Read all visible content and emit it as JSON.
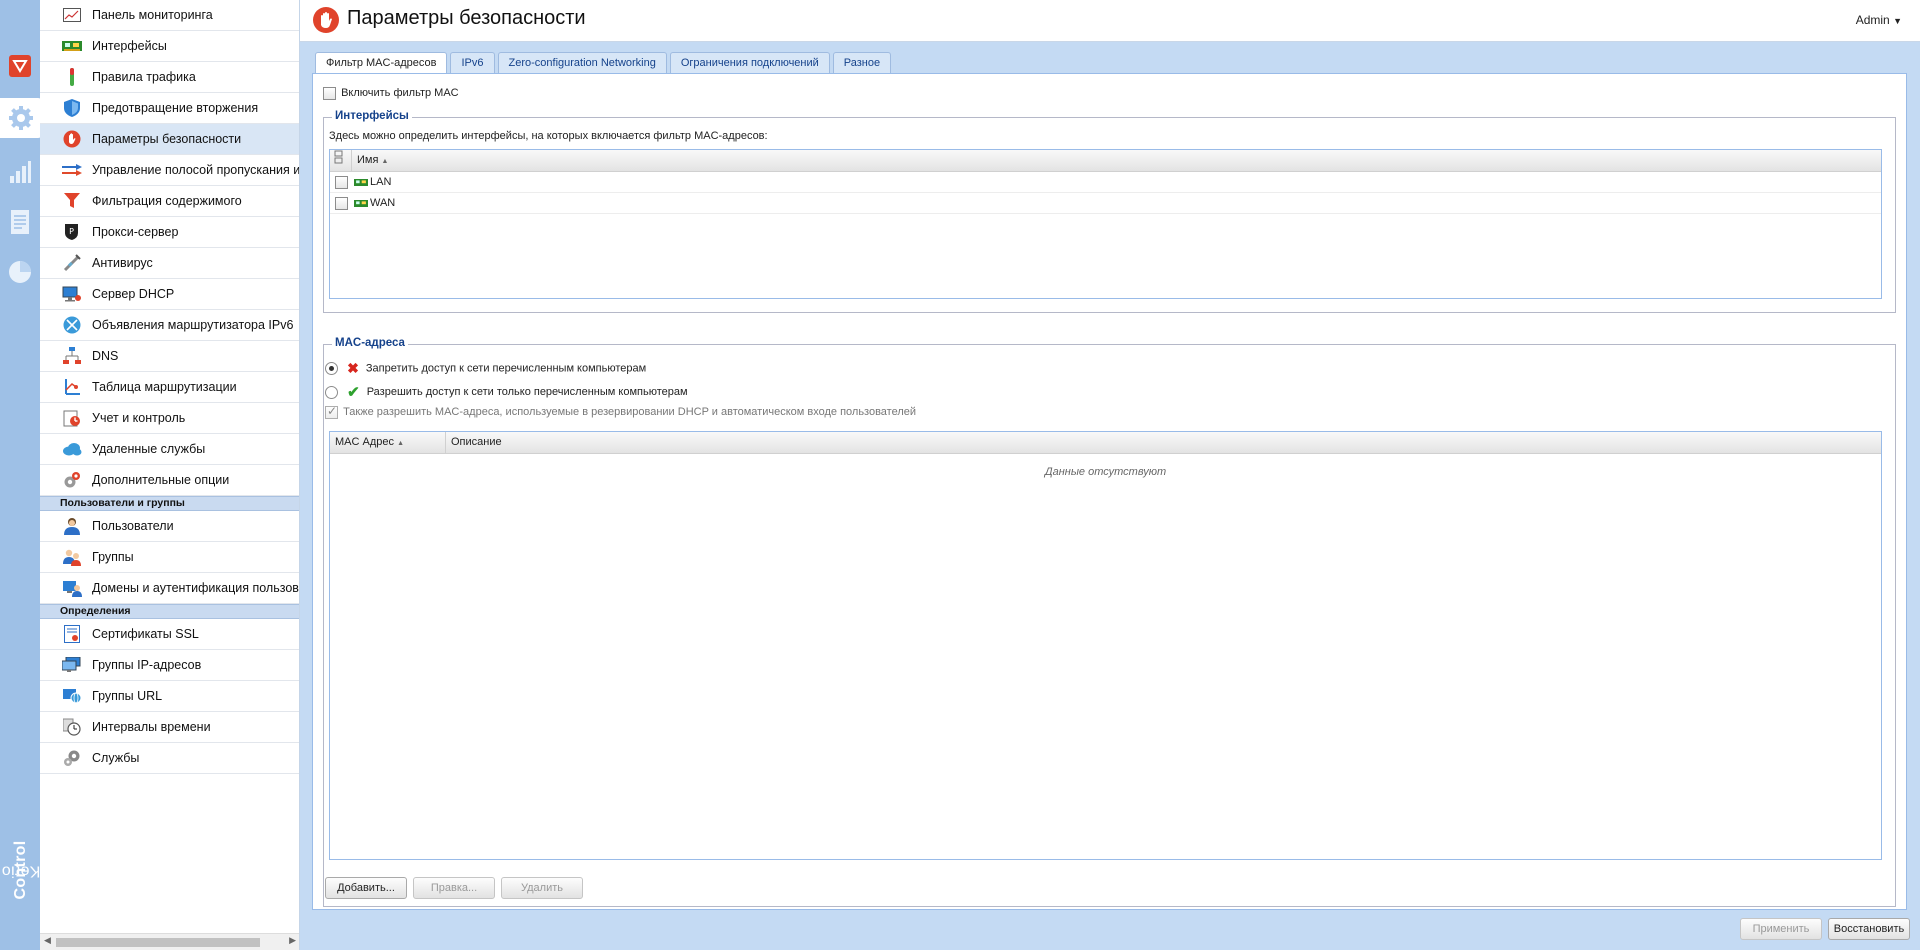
{
  "header": {
    "title": "Параметры безопасности",
    "user": "Admin"
  },
  "brand": {
    "part1": "Kerio",
    "part2": "Control"
  },
  "nav": {
    "group1": [
      {
        "label": "Панель мониторинга",
        "icon": "dashboard-icon"
      },
      {
        "label": "Интерфейсы",
        "icon": "network-card-icon"
      },
      {
        "label": "Правила трафика",
        "icon": "traffic-rule-icon"
      },
      {
        "label": "Предотвращение вторжения",
        "icon": "shield-icon"
      },
      {
        "label": "Параметры безопасности",
        "icon": "stop-hand-icon",
        "selected": true
      },
      {
        "label": "Управление полосой пропускания и",
        "icon": "bandwidth-icon"
      },
      {
        "label": "Фильтрация содержимого",
        "icon": "filter-funnel-icon"
      },
      {
        "label": "Прокси-сервер",
        "icon": "proxy-icon"
      },
      {
        "label": "Антивирус",
        "icon": "antivirus-icon"
      },
      {
        "label": "Сервер DHCP",
        "icon": "dhcp-icon"
      },
      {
        "label": "Объявления маршрутизатора IPv6",
        "icon": "router-ipv6-icon"
      },
      {
        "label": "DNS",
        "icon": "dns-icon"
      },
      {
        "label": "Таблица маршрутизации",
        "icon": "routing-table-icon"
      },
      {
        "label": "Учет и контроль",
        "icon": "accounting-icon"
      },
      {
        "label": "Удаленные службы",
        "icon": "cloud-icon"
      },
      {
        "label": "Дополнительные опции",
        "icon": "advanced-options-icon"
      }
    ],
    "section2": "Пользователи и группы",
    "group2": [
      {
        "label": "Пользователи",
        "icon": "user-icon"
      },
      {
        "label": "Группы",
        "icon": "group-icon"
      },
      {
        "label": "Домены и аутентификация пользовате",
        "icon": "domain-auth-icon"
      }
    ],
    "section3": "Определения",
    "group3": [
      {
        "label": "Сертификаты SSL",
        "icon": "certificate-icon"
      },
      {
        "label": "Группы IP-адресов",
        "icon": "ip-group-icon"
      },
      {
        "label": "Группы URL",
        "icon": "url-group-icon"
      },
      {
        "label": "Интервалы времени",
        "icon": "clock-icon"
      },
      {
        "label": "Службы",
        "icon": "services-icon"
      }
    ]
  },
  "tabs": [
    {
      "label": "Фильтр MAC-адресов",
      "active": true
    },
    {
      "label": "IPv6"
    },
    {
      "label": "Zero-configuration Networking"
    },
    {
      "label": "Ограничения подключений"
    },
    {
      "label": "Разное"
    }
  ],
  "mac_filter": {
    "enable_label": "Включить фильтр MAC",
    "interfaces": {
      "legend": "Интерфейсы",
      "description": "Здесь можно определить интерфейсы, на которых включается фильтр MAC-адресов:",
      "column_name": "Имя",
      "rows": [
        {
          "name": "LAN"
        },
        {
          "name": "WAN"
        }
      ]
    },
    "mac_addresses": {
      "legend": "MAC-адреса",
      "deny_label": "Запретить доступ к сети перечисленным компьютерам",
      "allow_label": "Разрешить доступ к сети только перечисленным компьютерам",
      "also_allow_label": "Также разрешить MAC-адреса, используемые в резервировании DHCP и автоматическом входе пользователей",
      "col_mac": "MAC Адрес",
      "col_desc": "Описание",
      "empty_text": "Данные отсутствуют"
    },
    "buttons": {
      "add": "Добавить...",
      "edit": "Правка...",
      "delete": "Удалить"
    }
  },
  "footer_buttons": {
    "apply": "Применить",
    "reset": "Восстановить"
  },
  "colors": {
    "strip": "#9ec0e6",
    "main_bg": "#c4daf3",
    "accent": "#15428b",
    "security_red": "#e0432b"
  }
}
